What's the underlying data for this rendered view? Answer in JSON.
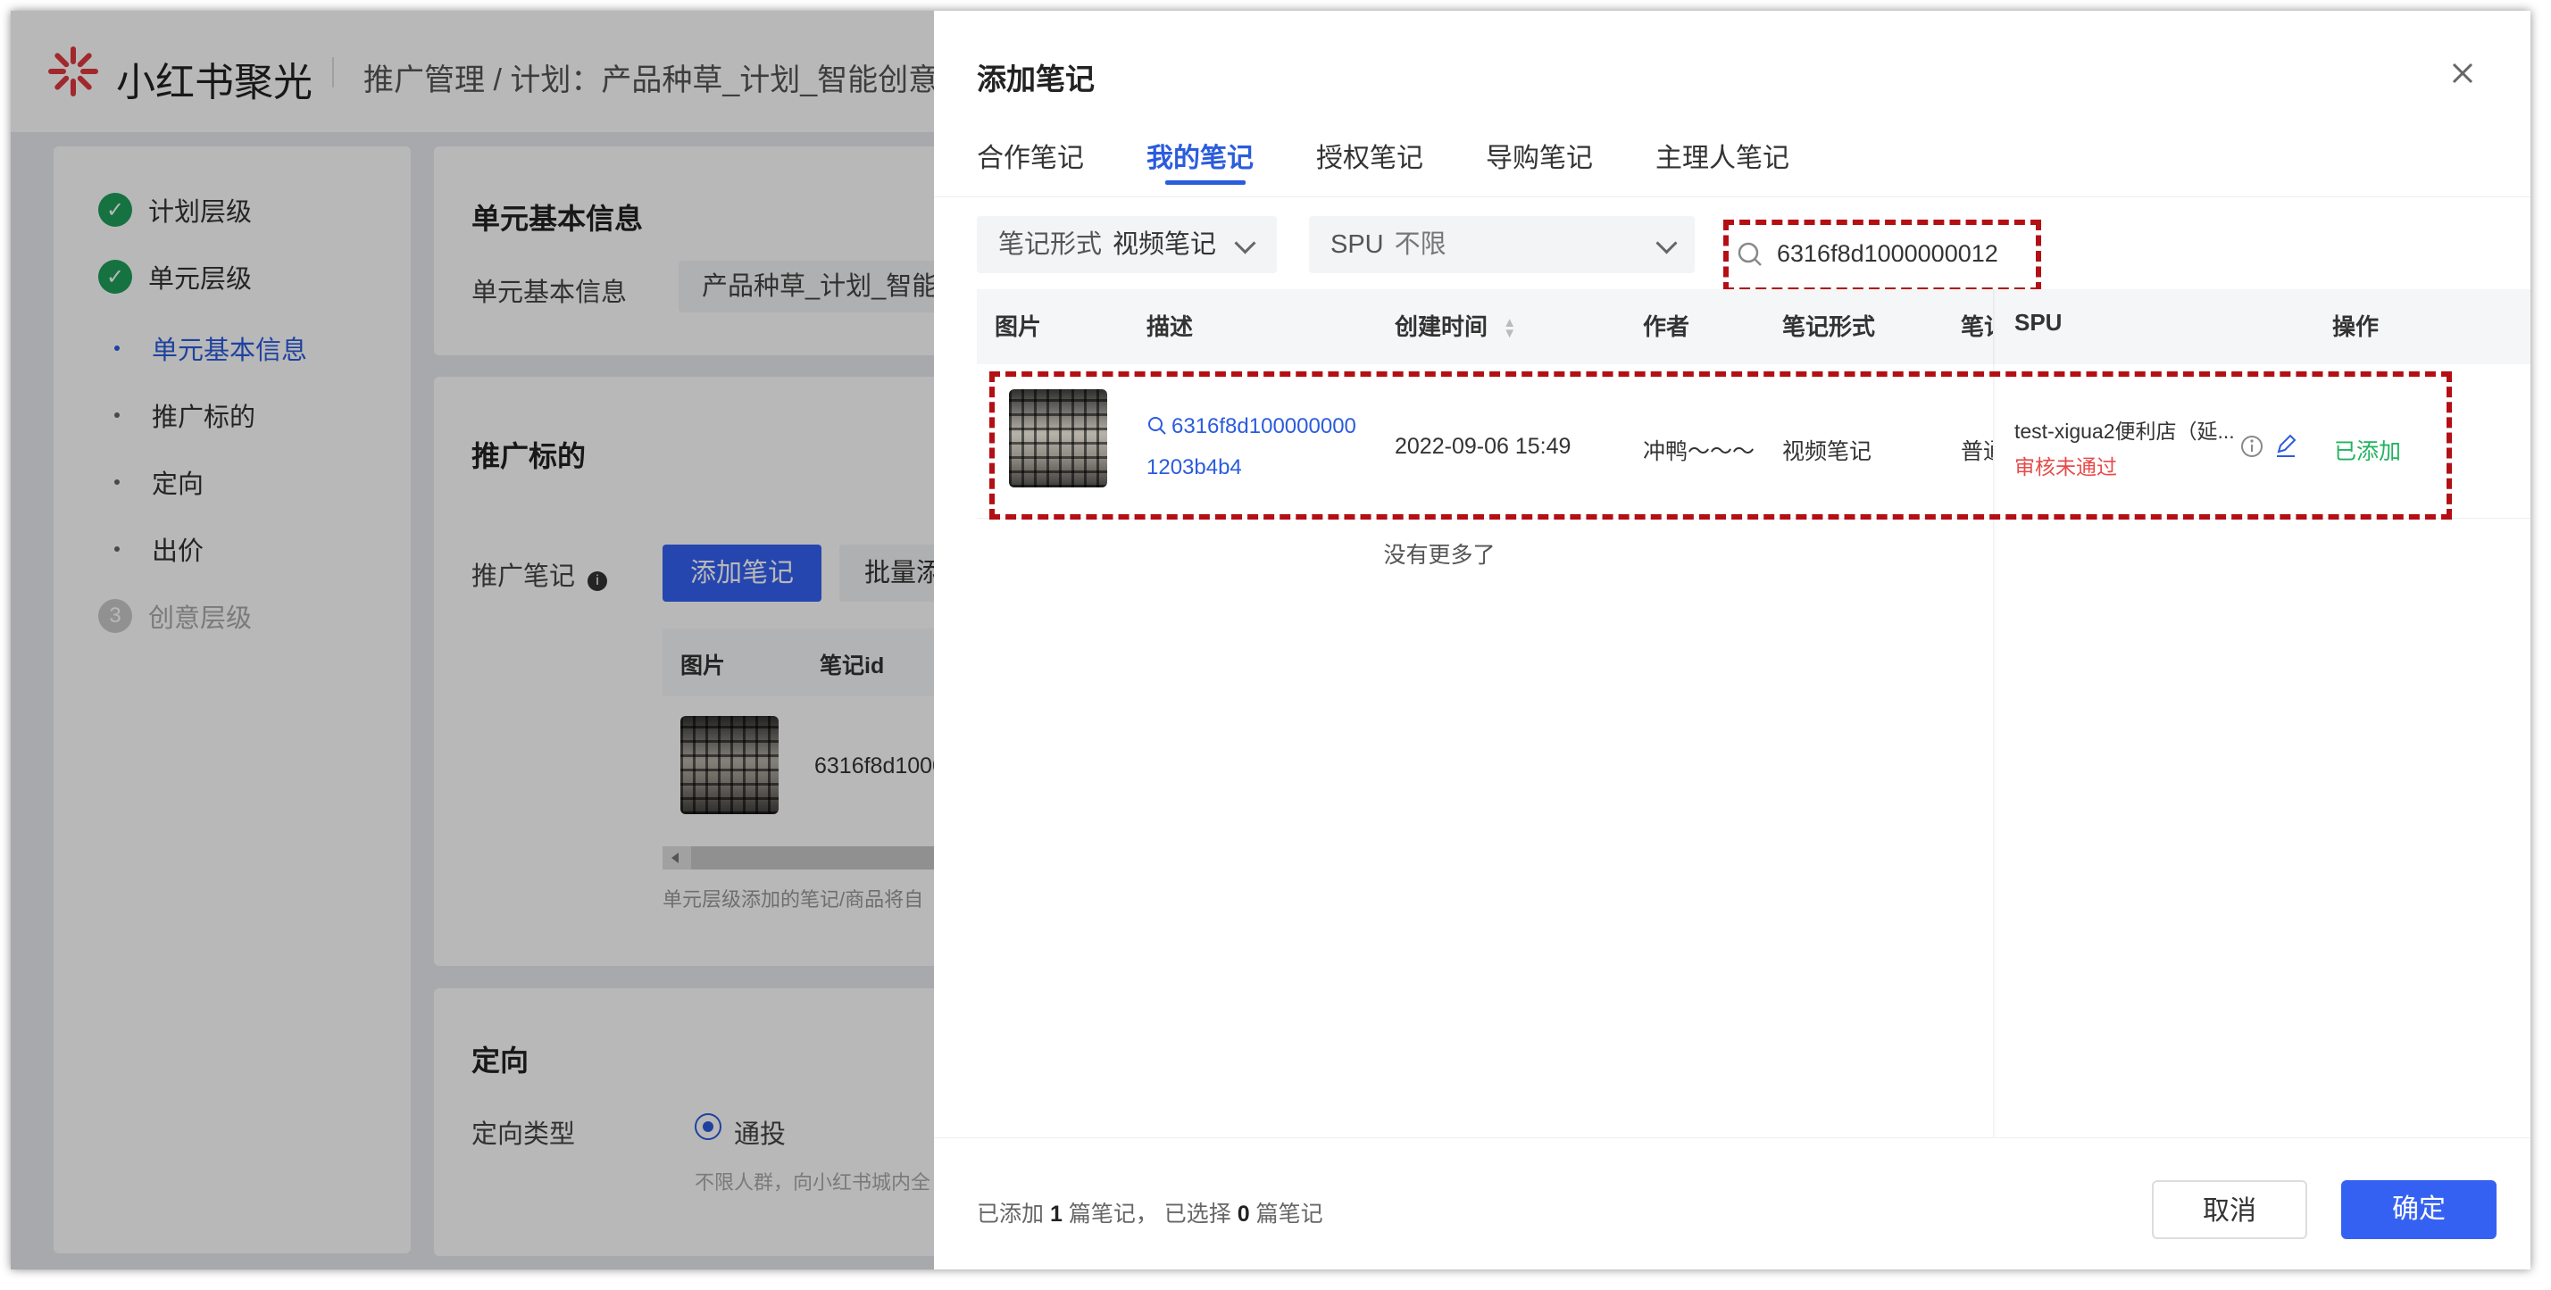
{
  "app": {
    "logo_text": "小红书聚光",
    "breadcrumb": "推广管理 / 计划：产品种草_计划_智能创意复"
  },
  "sidebar": {
    "steps": [
      {
        "label": "计划层级"
      },
      {
        "label": "单元层级"
      },
      {
        "label": "创意层级",
        "number": "3"
      }
    ],
    "sub_items": [
      {
        "label": "单元基本信息"
      },
      {
        "label": "推广标的"
      },
      {
        "label": "定向"
      },
      {
        "label": "出价"
      }
    ]
  },
  "main": {
    "basic_title": "单元基本信息",
    "basic_label": "单元基本信息",
    "basic_value": "产品种草_计划_智能创",
    "target_title": "推广标的",
    "note_label": "推广笔记",
    "add_note_button": "添加笔记",
    "batch_button": "批量添",
    "table_headers": [
      "图片",
      "笔记id"
    ],
    "note_id": "6316f8d1000",
    "hint": "单元层级添加的笔记/商品将自",
    "targeting_title": "定向",
    "targeting_type_label": "定向类型",
    "targeting_option": "通投",
    "targeting_hint": "不限人群，向小红书城内全"
  },
  "drawer": {
    "title": "添加笔记",
    "tabs": [
      "合作笔记",
      "我的笔记",
      "授权笔记",
      "导购笔记",
      "主理人笔记"
    ],
    "active_tab": 1,
    "filters": {
      "form_key": "笔记形式",
      "form_value": "视频笔记",
      "spu_key": "SPU",
      "spu_value": "不限"
    },
    "search_value": "6316f8d1000000012",
    "columns": [
      "图片",
      "描述",
      "创建时间",
      "作者",
      "笔记形式",
      "笔记",
      "SPU",
      "操作"
    ],
    "row": {
      "desc_line1": "6316f8d100000000",
      "desc_line2": "1203b4b4",
      "created": "2022-09-06 15:49",
      "author": "冲鸭～～～",
      "form": "视频笔记",
      "note_type": "普通",
      "spu_name": "test-xigua2便利店（延...",
      "spu_status": "审核未通过",
      "action": "已添加"
    },
    "no_more": "没有更多了",
    "summary": {
      "prefix": "已添加",
      "added": "1",
      "mid": "篇笔记，  已选择",
      "selected": "0",
      "suffix": "篇笔记"
    },
    "cancel_button": "取消",
    "confirm_button": "确定"
  },
  "colors": {
    "accent": "#3561f3",
    "link": "#2b5cdd",
    "success": "#1f9e5a",
    "error": "#e84a4a",
    "added_green": "#22b35e",
    "annotation_red": "#b30f14"
  }
}
